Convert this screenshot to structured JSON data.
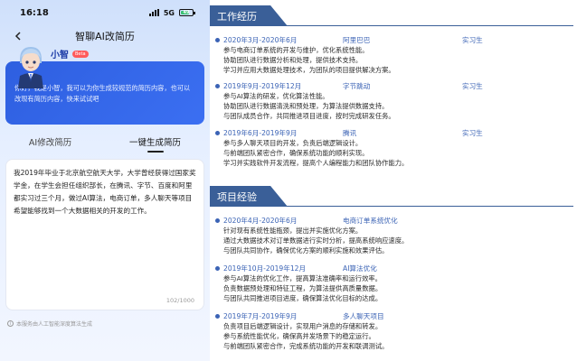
{
  "phone": {
    "status_bar": {
      "time": "16:18",
      "network": "5G",
      "battery": "49"
    },
    "nav": {
      "back_icon": "chevron-left-icon",
      "title": "智聊AI改简历"
    },
    "assistant": {
      "name": "小智",
      "badge": "Beta",
      "greeting": "你好，我是小智，我可以为你生成较规范的简历内容，也可以改现有简历内容，快来试试吧"
    },
    "tabs": [
      {
        "label": "AI修改简历",
        "active": false
      },
      {
        "label": "一键生成简历",
        "active": true
      }
    ],
    "input": {
      "value": "我2019年毕业于北京航空航天大学，大学曾经获得过国家奖学金，在学生会担任组织部长，在腾讯、字节、百度和阿里都实习过三个月，做过AI算法，电商订单，多人聊天等项目希望能够找到一个大数据相关的开发的工作。",
      "count": "102/1000"
    },
    "disclaimer": "本服务由人工智能深度算法生成"
  },
  "resume": {
    "work": {
      "title": "工作经历",
      "entries": [
        {
          "date": "2020年3月-2020年6月",
          "org": "阿里巴巴",
          "role": "实习生",
          "lines": [
            "参与电商订单系统的开发与维护，优化系统性能。",
            "协助团队进行数据分析和处理，提供技术支持。",
            "学习并应用大数据处理技术，为团队的项目提供解决方案。"
          ]
        },
        {
          "date": "2019年9月-2019年12月",
          "org": "字节跳动",
          "role": "实习生",
          "lines": [
            "参与AI算法的研发，优化算法性能。",
            "协助团队进行数据清洗和预处理，为算法提供数据支持。",
            "与团队成员合作，共同推进项目进度，按时完成研发任务。"
          ]
        },
        {
          "date": "2019年6月-2019年9月",
          "org": "腾讯",
          "role": "实习生",
          "lines": [
            "参与多人聊天项目的开发，负责后端逻辑设计。",
            "与前端团队紧密合作，确保系统功能的顺利实现。",
            "学习并实践软件开发流程，提高个人编程能力和团队协作能力。"
          ]
        }
      ]
    },
    "projects": {
      "title": "项目经验",
      "entries": [
        {
          "date": "2020年4月-2020年6月",
          "org": "电商订单系统优化",
          "role": "",
          "lines": [
            "针对现有系统性能瓶颈，提出并实施优化方案。",
            "通过大数据技术对订单数据进行实时分析，提高系统响应速度。",
            "与团队共同协作，确保优化方案的顺利实施和效果评估。"
          ]
        },
        {
          "date": "2019年10月-2019年12月",
          "org": "AI算法优化",
          "role": "",
          "lines": [
            "参与AI算法的优化工作，提高算法准确率和运行效率。",
            "负责数据预处理和特征工程，为算法提供高质量数据。",
            "与团队共同推进项目进度，确保算法优化目标的达成。"
          ]
        },
        {
          "date": "2019年7月-2019年9月",
          "org": "多人聊天项目",
          "role": "",
          "lines": [
            "负责项目后端逻辑设计，实现用户消息的存储和转发。",
            "参与系统性能优化，确保高并发场景下的稳定运行。",
            "与前端团队紧密合作，完成系统功能的开发和联调测试。"
          ]
        }
      ]
    }
  },
  "colors": {
    "accent": "#3a5f98",
    "link_blue": "#3b63b5",
    "card_blue": "#2e5fe0"
  }
}
